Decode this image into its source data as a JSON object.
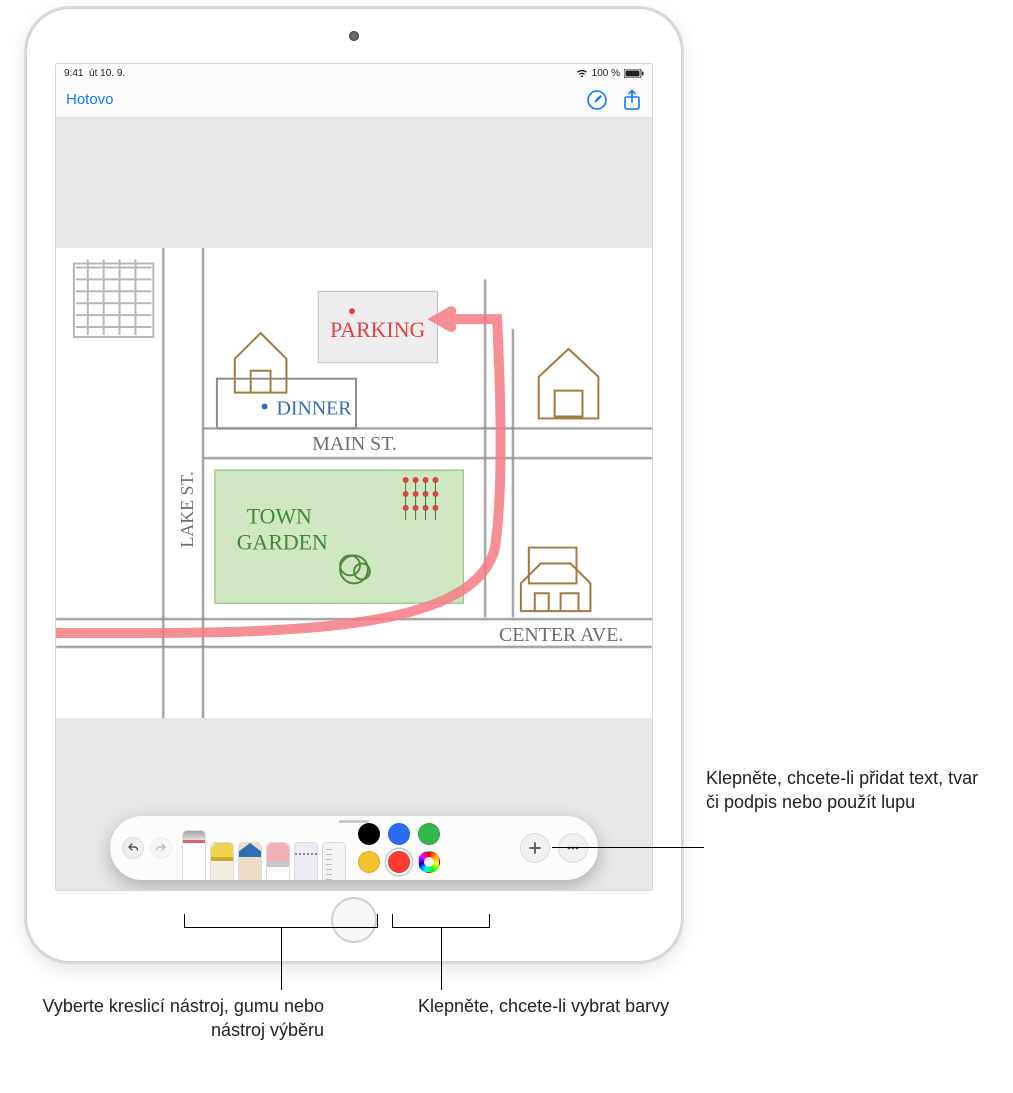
{
  "status": {
    "time": "9:41",
    "date": "út 10. 9.",
    "battery": "100 %"
  },
  "nav": {
    "done": "Hotovo"
  },
  "sketch": {
    "labels": {
      "parking": "PARKING",
      "dinner": "DINNER",
      "main_st": "MAIN ST.",
      "lake_st": "LAKE ST.",
      "town": "TOWN",
      "garden": "GARDEN",
      "center_ave": "CENTER AVE."
    }
  },
  "colors": {
    "black": "#000000",
    "blue": "#2a6df4",
    "green": "#2fb84c",
    "yellow": "#f4c431",
    "red": "#ff3b30"
  },
  "callouts": {
    "add": "Klepněte, chcete-li přidat text, tvar či podpis nebo použít lupu",
    "tools": "Vyberte kreslicí nástroj, gumu nebo nástroj výběru",
    "colors": "Klepněte, chcete-li vybrat barvy"
  }
}
